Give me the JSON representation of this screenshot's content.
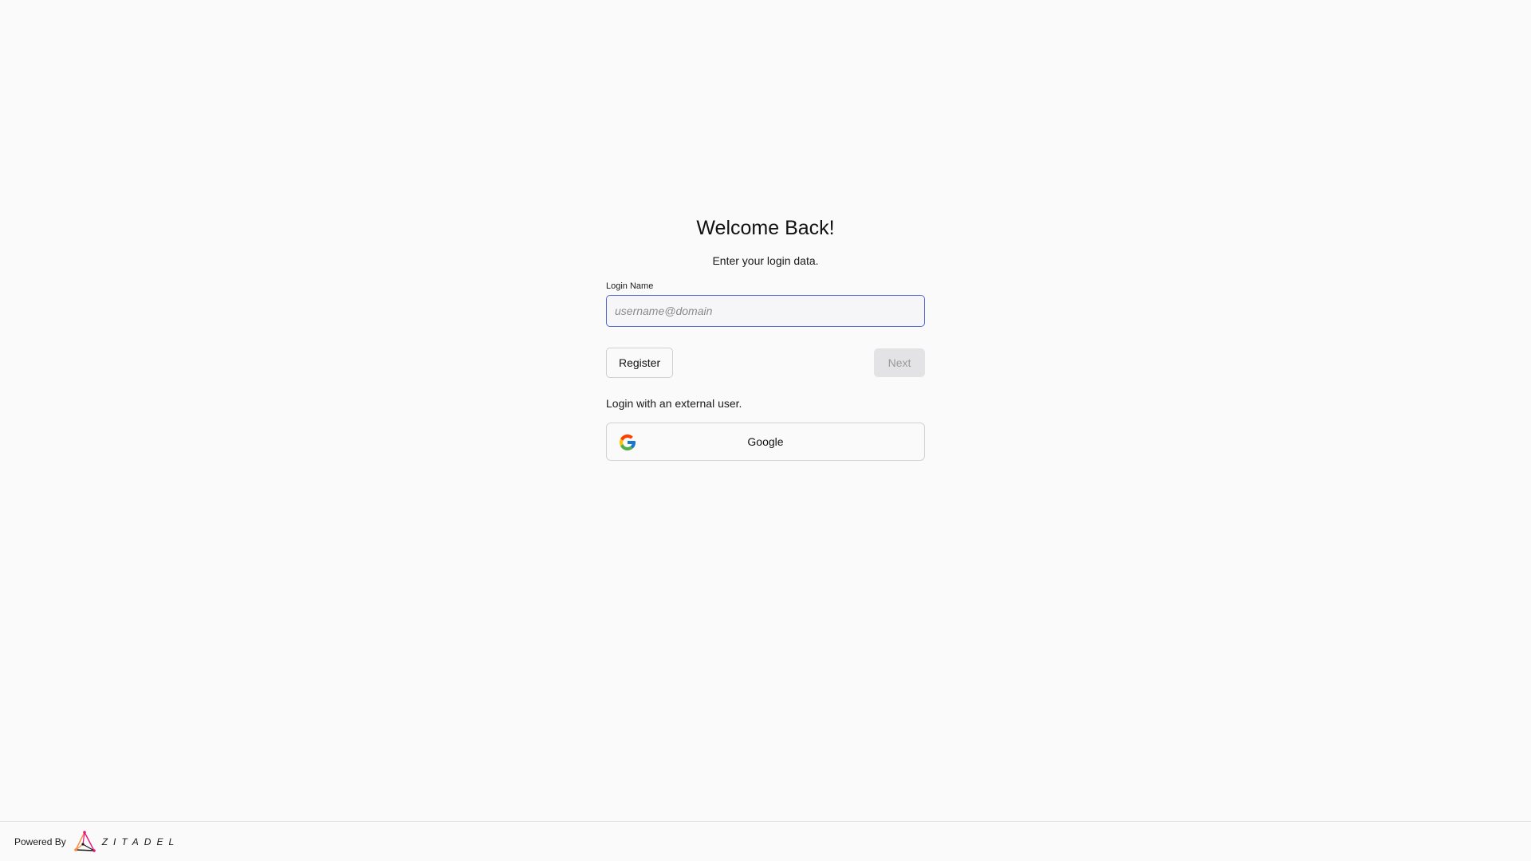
{
  "login": {
    "title": "Welcome Back!",
    "subtitle": "Enter your login data.",
    "login_name_label": "Login Name",
    "login_name_value": "",
    "login_name_placeholder": "username@domain",
    "register_label": "Register",
    "next_label": "Next",
    "external_label": "Login with an external user.",
    "google_label": "Google",
    "google_icon": "google-icon"
  },
  "footer": {
    "powered_by": "Powered By",
    "logo_text": "ZITADEL",
    "logo_icon": "zitadel-logo-icon"
  },
  "colors": {
    "background": "#fafafa",
    "input_focus_border": "#5469d4",
    "next_disabled_bg": "#e3e3e6",
    "next_disabled_text": "#9a9a9e"
  }
}
